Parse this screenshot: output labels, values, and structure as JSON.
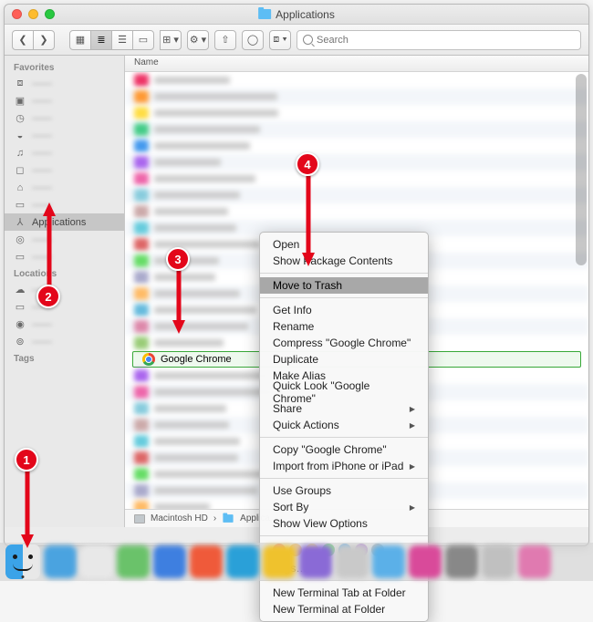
{
  "window": {
    "title": "Applications"
  },
  "toolbar": {
    "search_placeholder": "Search"
  },
  "sidebar": {
    "section_favorites": "Favorites",
    "section_locations": "Locations",
    "section_tags": "Tags",
    "applications_label": "Applications"
  },
  "list": {
    "column_name": "Name",
    "selected_item": "Google Chrome",
    "blurred_count_before": 17,
    "blurred_count_after": 10
  },
  "pathbar": {
    "disk": "Macintosh HD",
    "folder": "Applica"
  },
  "context_menu": {
    "open": "Open",
    "show_contents": "Show Package Contents",
    "move_to_trash": "Move to Trash",
    "get_info": "Get Info",
    "rename": "Rename",
    "compress": "Compress \"Google Chrome\"",
    "duplicate": "Duplicate",
    "make_alias": "Make Alias",
    "quick_look": "Quick Look \"Google Chrome\"",
    "share": "Share",
    "quick_actions": "Quick Actions",
    "copy": "Copy \"Google Chrome\"",
    "import": "Import from iPhone or iPad",
    "use_groups": "Use Groups",
    "sort_by": "Sort By",
    "view_options": "Show View Options",
    "tags": "Tags…",
    "new_tab": "New Terminal Tab at Folder",
    "new_term": "New Terminal at Folder",
    "tag_colors": [
      "#ff5e57",
      "#ffb02e",
      "#ffe12d",
      "#2ecc40",
      "#2196f3",
      "#a25ad6",
      "#9e9e9e"
    ]
  },
  "annotations": {
    "1": "1",
    "2": "2",
    "3": "3",
    "4": "4"
  }
}
